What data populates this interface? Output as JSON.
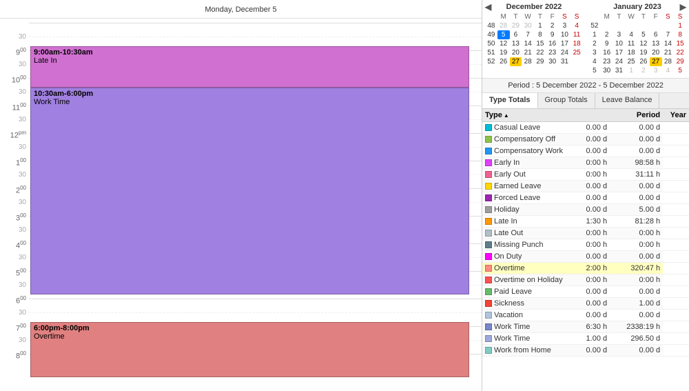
{
  "header": {
    "title": "Monday, December 5"
  },
  "period": "Period : 5 December 2022 - 5 December 2022",
  "tabs": [
    {
      "label": "Type Totals",
      "active": true
    },
    {
      "label": "Group Totals",
      "active": false
    },
    {
      "label": "Leave Balance",
      "active": false
    }
  ],
  "events": [
    {
      "time": "9:00am-10:30am",
      "label": "Late In",
      "color": "#d070d0",
      "topPx": 130,
      "heightPx": 120
    },
    {
      "time": "10:30am-6:00pm",
      "label": "Work Time",
      "color": "#a080e0",
      "topPx": 250,
      "heightPx": 380
    },
    {
      "time": "6:00pm-8:00pm",
      "label": "Overtime",
      "color": "#e08080",
      "topPx": 630,
      "heightPx": 160
    }
  ],
  "hours": [
    {
      "label": "30",
      "superscript": ""
    },
    {
      "label": "9",
      "superscript": "00"
    },
    {
      "label": "30",
      "superscript": ""
    },
    {
      "label": "10",
      "superscript": "00"
    },
    {
      "label": "30",
      "superscript": ""
    },
    {
      "label": "11",
      "superscript": "00"
    },
    {
      "label": "30",
      "superscript": ""
    },
    {
      "label": "12",
      "superscript": "pm"
    },
    {
      "label": "30",
      "superscript": ""
    },
    {
      "label": "1",
      "superscript": "00"
    },
    {
      "label": "30",
      "superscript": ""
    },
    {
      "label": "2",
      "superscript": "00"
    },
    {
      "label": "30",
      "superscript": ""
    },
    {
      "label": "3",
      "superscript": "00"
    },
    {
      "label": "30",
      "superscript": ""
    },
    {
      "label": "4",
      "superscript": "00"
    },
    {
      "label": "30",
      "superscript": ""
    },
    {
      "label": "5",
      "superscript": "00"
    },
    {
      "label": "30",
      "superscript": ""
    },
    {
      "label": "6",
      "superscript": "00"
    },
    {
      "label": "30",
      "superscript": ""
    },
    {
      "label": "7",
      "superscript": "00"
    },
    {
      "label": "30",
      "superscript": ""
    },
    {
      "label": "8",
      "superscript": "00"
    }
  ],
  "dec2022": {
    "title": "December 2022",
    "weekdays": [
      "M",
      "T",
      "W",
      "T",
      "F",
      "S",
      "S"
    ],
    "weeks": [
      {
        "num": "48",
        "days": [
          {
            "d": "28",
            "om": true
          },
          {
            "d": "29",
            "om": true
          },
          {
            "d": "30",
            "om": true
          },
          {
            "d": "1"
          },
          {
            "d": "2"
          },
          {
            "d": "3"
          },
          {
            "d": "4",
            "we": true
          }
        ]
      },
      {
        "num": "49",
        "days": [
          {
            "d": "5",
            "today": true
          },
          {
            "d": "6"
          },
          {
            "d": "7"
          },
          {
            "d": "8"
          },
          {
            "d": "9"
          },
          {
            "d": "10"
          },
          {
            "d": "11",
            "we": true
          }
        ]
      },
      {
        "num": "50",
        "days": [
          {
            "d": "12"
          },
          {
            "d": "13"
          },
          {
            "d": "14"
          },
          {
            "d": "15"
          },
          {
            "d": "16"
          },
          {
            "d": "17"
          },
          {
            "d": "18",
            "we": true
          }
        ]
      },
      {
        "num": "51",
        "days": [
          {
            "d": "19"
          },
          {
            "d": "20"
          },
          {
            "d": "21"
          },
          {
            "d": "22"
          },
          {
            "d": "23"
          },
          {
            "d": "24"
          },
          {
            "d": "25",
            "we": true
          }
        ]
      },
      {
        "num": "52",
        "days": [
          {
            "d": "26"
          },
          {
            "d": "27",
            "sel": true
          },
          {
            "d": "28"
          },
          {
            "d": "29"
          },
          {
            "d": "30"
          },
          {
            "d": "31"
          },
          {
            "d": "",
            "om": true
          }
        ]
      }
    ]
  },
  "jan2023": {
    "title": "January 2023",
    "weekdays": [
      "M",
      "T",
      "W",
      "T",
      "F",
      "S",
      "S"
    ],
    "weeks": [
      {
        "num": "52",
        "days": [
          {
            "d": ""
          },
          {
            "d": ""
          },
          {
            "d": ""
          },
          {
            "d": ""
          },
          {
            "d": ""
          },
          {
            "d": ""
          },
          {
            "d": "1",
            "we": true
          }
        ]
      },
      {
        "num": "1",
        "days": [
          {
            "d": "2"
          },
          {
            "d": "3"
          },
          {
            "d": "4"
          },
          {
            "d": "5"
          },
          {
            "d": "6"
          },
          {
            "d": "7"
          },
          {
            "d": "8",
            "we": true
          }
        ]
      },
      {
        "num": "2",
        "days": [
          {
            "d": "9"
          },
          {
            "d": "10"
          },
          {
            "d": "11"
          },
          {
            "d": "12"
          },
          {
            "d": "13"
          },
          {
            "d": "14"
          },
          {
            "d": "15",
            "we": true
          }
        ]
      },
      {
        "num": "3",
        "days": [
          {
            "d": "16"
          },
          {
            "d": "17"
          },
          {
            "d": "18"
          },
          {
            "d": "19"
          },
          {
            "d": "20"
          },
          {
            "d": "21"
          },
          {
            "d": "22",
            "we": true
          }
        ]
      },
      {
        "num": "4",
        "days": [
          {
            "d": "23"
          },
          {
            "d": "24"
          },
          {
            "d": "25"
          },
          {
            "d": "26"
          },
          {
            "d": "27",
            "sel": true
          },
          {
            "d": "28"
          },
          {
            "d": "29",
            "we": true
          }
        ]
      },
      {
        "num": "5",
        "days": [
          {
            "d": "30"
          },
          {
            "d": "31"
          },
          {
            "d": "1",
            "om": true
          },
          {
            "d": "2",
            "om": true
          },
          {
            "d": "3",
            "om": true
          },
          {
            "d": "4",
            "om": true
          },
          {
            "d": "5",
            "om": true,
            "we": true
          }
        ]
      }
    ]
  },
  "table": {
    "columns": [
      "Type",
      "",
      "Period",
      "Year"
    ],
    "rows": [
      {
        "color": "#00bcd4",
        "label": "Casual Leave",
        "period": "0.00 d",
        "year": "0.00 d"
      },
      {
        "color": "#8bc34a",
        "label": "Compensatory Off",
        "period": "0.00 d",
        "year": "0.00 d"
      },
      {
        "color": "#2196f3",
        "label": "Compensatory Work",
        "period": "0.00 d",
        "year": "0.00 d"
      },
      {
        "color": "#e040fb",
        "label": "Early In",
        "period": "0:00 h",
        "year": "98:58 h"
      },
      {
        "color": "#f06292",
        "label": "Early Out",
        "period": "0:00 h",
        "year": "31:11 h"
      },
      {
        "color": "#ffd600",
        "label": "Earned Leave",
        "period": "0.00 d",
        "year": "0.00 d"
      },
      {
        "color": "#9c27b0",
        "label": "Forced Leave",
        "period": "0.00 d",
        "year": "0.00 d"
      },
      {
        "color": "#9e9e9e",
        "label": "Holiday",
        "period": "0.00 d",
        "year": "5.00 d"
      },
      {
        "color": "#ff9800",
        "label": "Late In",
        "period": "1:30 h",
        "year": "81:28 h"
      },
      {
        "color": "#b0bec5",
        "label": "Late Out",
        "period": "0:00 h",
        "year": "0:00 h"
      },
      {
        "color": "#607d8b",
        "label": "Missing Punch",
        "period": "0:00 h",
        "year": "0:00 h"
      },
      {
        "color": "#ff00ff",
        "label": "On Duty",
        "period": "0.00 d",
        "year": "0.00 d"
      },
      {
        "color": "#ff8a80",
        "label": "Overtime",
        "period": "2:00 h",
        "year": "320:47 h",
        "highlight": true
      },
      {
        "color": "#ff5252",
        "label": "Overtime on Holiday",
        "period": "0:00 h",
        "year": "0:00 h"
      },
      {
        "color": "#66bb6a",
        "label": "Paid Leave",
        "period": "0.00 d",
        "year": "0.00 d"
      },
      {
        "color": "#f44336",
        "label": "Sickness",
        "period": "0.00 d",
        "year": "1.00 d"
      },
      {
        "color": "#b0c4de",
        "label": "Vacation",
        "period": "0.00 d",
        "year": "0.00 d"
      },
      {
        "color": "#7986cb",
        "label": "Work Time",
        "period": "6:30 h",
        "year": "2338:19 h"
      },
      {
        "color": "#9fa8da",
        "label": "Work Time",
        "period": "1.00 d",
        "year": "296.50 d"
      },
      {
        "color": "#80cbc4",
        "label": "Work from Home",
        "period": "0.00 d",
        "year": "0.00 d"
      }
    ]
  }
}
